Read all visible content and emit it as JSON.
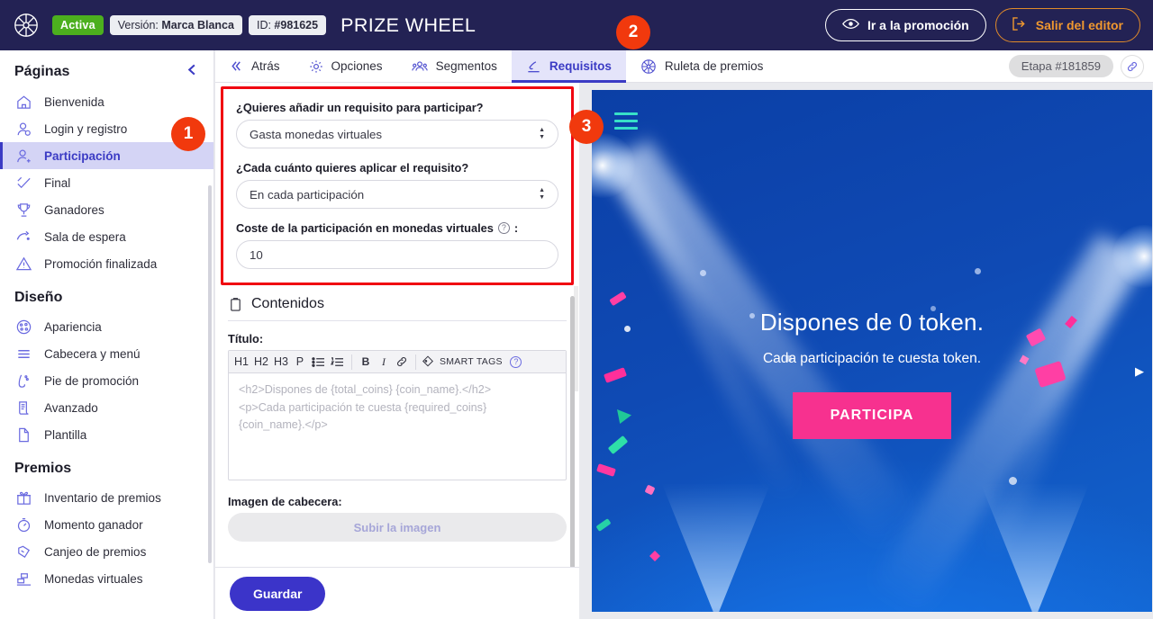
{
  "topbar": {
    "logo_icon": "prize-wheel-logo",
    "status_badge": "Activa",
    "version_prefix": "Versión: ",
    "version_value": "Marca Blanca",
    "id_prefix": "ID: ",
    "id_value": "#981625",
    "title": "PRIZE WHEEL",
    "preview_button": "Ir a la promoción",
    "exit_button": "Salir del editor",
    "bg_color": "#232254",
    "badge_color": "#4caf1e",
    "exit_color": "#f0982f"
  },
  "sidebar": {
    "pages_title": "Páginas",
    "pages": [
      {
        "label": "Bienvenida",
        "icon": "home-icon"
      },
      {
        "label": "Login y registro",
        "icon": "user-login-icon"
      },
      {
        "label": "Participación",
        "icon": "user-add-icon"
      },
      {
        "label": "Final",
        "icon": "check-icon"
      },
      {
        "label": "Ganadores",
        "icon": "trophy-icon"
      },
      {
        "label": "Sala de espera",
        "icon": "waiting-room-icon"
      },
      {
        "label": "Promoción finalizada",
        "icon": "warning-icon"
      }
    ],
    "active_page": "Participación",
    "design_title": "Diseño",
    "design": [
      {
        "label": "Apariencia",
        "icon": "palette-icon"
      },
      {
        "label": "Cabecera y menú",
        "icon": "menu-lines-icon"
      },
      {
        "label": "Pie de promoción",
        "icon": "footer-icon"
      },
      {
        "label": "Avanzado",
        "icon": "document-code-icon"
      },
      {
        "label": "Plantilla",
        "icon": "page-icon"
      }
    ],
    "prizes_title": "Premios",
    "prizes": [
      {
        "label": "Inventario de premios",
        "icon": "gift-icon"
      },
      {
        "label": "Momento ganador",
        "icon": "stopwatch-icon"
      },
      {
        "label": "Canjeo de premios",
        "icon": "redeem-icon"
      },
      {
        "label": "Monedas virtuales",
        "icon": "coins-icon"
      }
    ],
    "accent_color": "#3b3bc4"
  },
  "tabbar": {
    "tabs": [
      {
        "label": "Atrás",
        "icon": "chevron-left-double-icon"
      },
      {
        "label": "Opciones",
        "icon": "gear-icon"
      },
      {
        "label": "Segmentos",
        "icon": "people-icon"
      },
      {
        "label": "Requisitos",
        "icon": "requirements-icon"
      },
      {
        "label": "Ruleta de premios",
        "icon": "wheel-icon"
      }
    ],
    "selected_tab": "Requisitos",
    "stage_chip": "Etapa #181859",
    "link_icon": "link-icon"
  },
  "requirements": {
    "question_1_label": "¿Quieres añadir un requisito para participar?",
    "question_1_value": "Gasta monedas virtuales",
    "question_2_label": "¿Cada cuánto quieres aplicar el requisito?",
    "question_2_value": "En cada participación",
    "cost_label": "Coste de la participación en monedas virtuales",
    "cost_label_suffix": ":",
    "cost_value": "10",
    "help_icon": "question-mark-icon",
    "highlight_color": "#f00711"
  },
  "contents": {
    "section_title": "Contenidos",
    "section_icon": "clipboard-icon",
    "title_label": "Título:",
    "toolbar": [
      {
        "label": "H1",
        "name": "heading1"
      },
      {
        "label": "H2",
        "name": "heading2"
      },
      {
        "label": "H3",
        "name": "heading3"
      },
      {
        "label": "P",
        "name": "paragraph"
      },
      {
        "label": "☰",
        "name": "bullet-list"
      },
      {
        "label": "≣",
        "name": "numbered-list"
      },
      {
        "label": "B",
        "name": "bold"
      },
      {
        "label": "I",
        "name": "italic"
      },
      {
        "label": "🔗",
        "name": "link"
      }
    ],
    "smart_tags_label": "SMART TAGS",
    "smart_tags_icon": "tag-icon",
    "editor_placeholder": "<h2>Dispones de {total_coins} {coin_name}.</h2>\n<p>Cada participación te cuesta {required_coins} {coin_name}.</p>",
    "image_label": "Imagen de cabecera:",
    "upload_button": "Subir la imagen",
    "save_button": "Guardar",
    "save_color": "#3b34c9"
  },
  "preview": {
    "hamburger_icon": "hamburger-menu-icon",
    "hamburger_color": "#37e0c8",
    "heading": "Dispones de 0 token.",
    "subtext": "Cada participación te cuesta token.",
    "cta_button": "PARTICIPA",
    "cta_color": "#f7318f",
    "background_color": "#0d45ae",
    "next_arrow_icon": "play-arrow-icon"
  },
  "callouts": [
    {
      "number": "1",
      "color": "#f1390d"
    },
    {
      "number": "2",
      "color": "#f1390d"
    },
    {
      "number": "3",
      "color": "#f1390d"
    }
  ]
}
